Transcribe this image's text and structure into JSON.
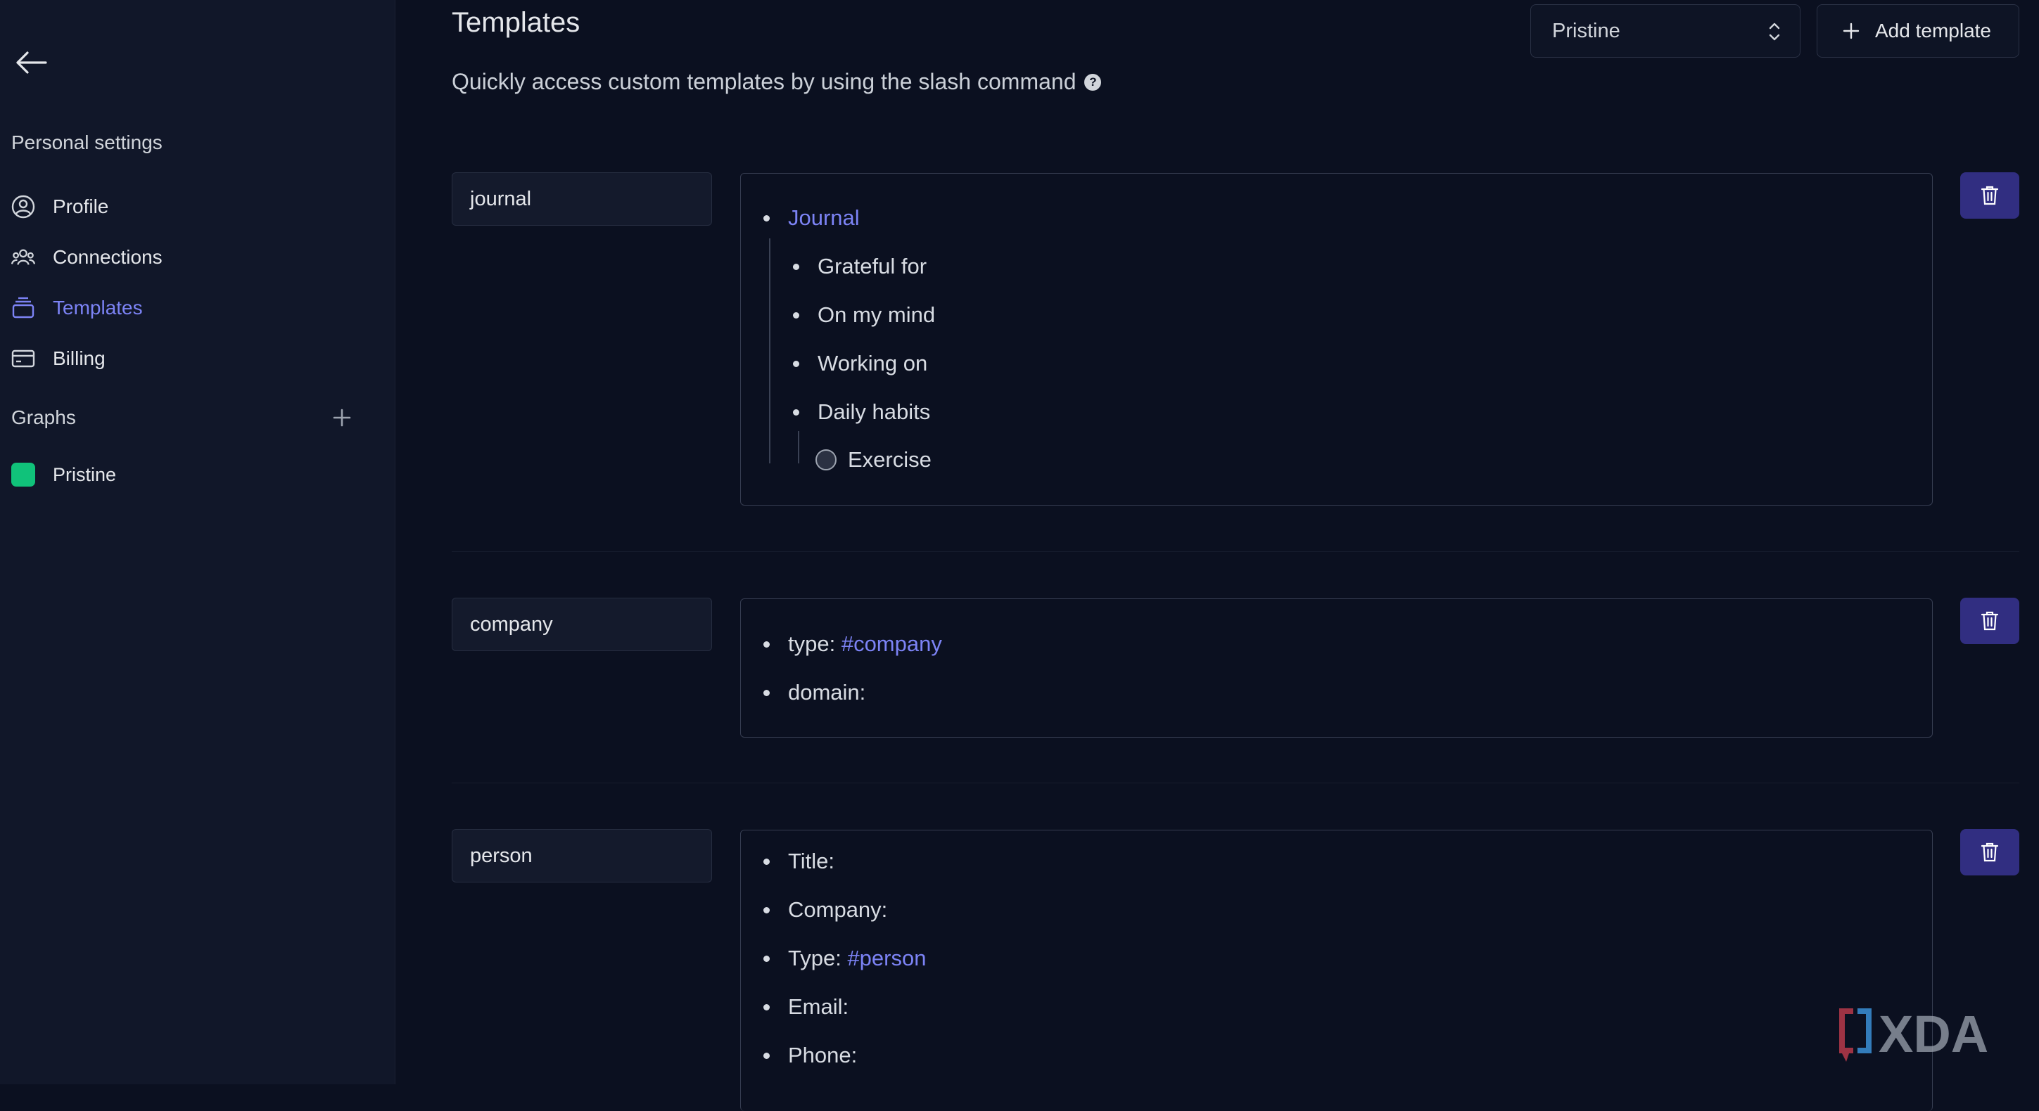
{
  "sidebar": {
    "heading": "Personal settings",
    "items": [
      {
        "label": "Profile",
        "icon": "user-circle-icon"
      },
      {
        "label": "Connections",
        "icon": "users-icon"
      },
      {
        "label": "Templates",
        "icon": "templates-icon",
        "active": true
      },
      {
        "label": "Billing",
        "icon": "credit-card-icon"
      }
    ],
    "graphs_heading": "Graphs",
    "graphs": [
      {
        "label": "Pristine",
        "color": "#10c27a"
      }
    ]
  },
  "main": {
    "title": "Templates",
    "subtitle": "Quickly access custom templates by using the slash command",
    "help_glyph": "?",
    "graph_select_value": "Pristine",
    "add_template_label": "Add template"
  },
  "templates": [
    {
      "name": "journal",
      "lines": [
        {
          "text": "Journal",
          "link": true
        },
        {
          "text": "Grateful for"
        },
        {
          "text": "On my mind"
        },
        {
          "text": "Working on"
        },
        {
          "text": "Daily habits"
        },
        {
          "text": "Exercise",
          "todo": true
        }
      ]
    },
    {
      "name": "company",
      "lines": [
        {
          "prefix": "type: ",
          "tag": "#company"
        },
        {
          "text": "domain:"
        }
      ]
    },
    {
      "name": "person",
      "lines": [
        {
          "text": "Title:"
        },
        {
          "text": "Company:"
        },
        {
          "prefix": "Type: ",
          "tag": "#person"
        },
        {
          "text": "Email:"
        },
        {
          "text": "Phone:"
        }
      ]
    }
  ],
  "watermark": "XDA",
  "colors": {
    "accent": "#7c83f5",
    "delete_button": "#312e81",
    "graph_swatch": "#10c27a",
    "background": "#0b1020",
    "sidebar": "#111729"
  }
}
